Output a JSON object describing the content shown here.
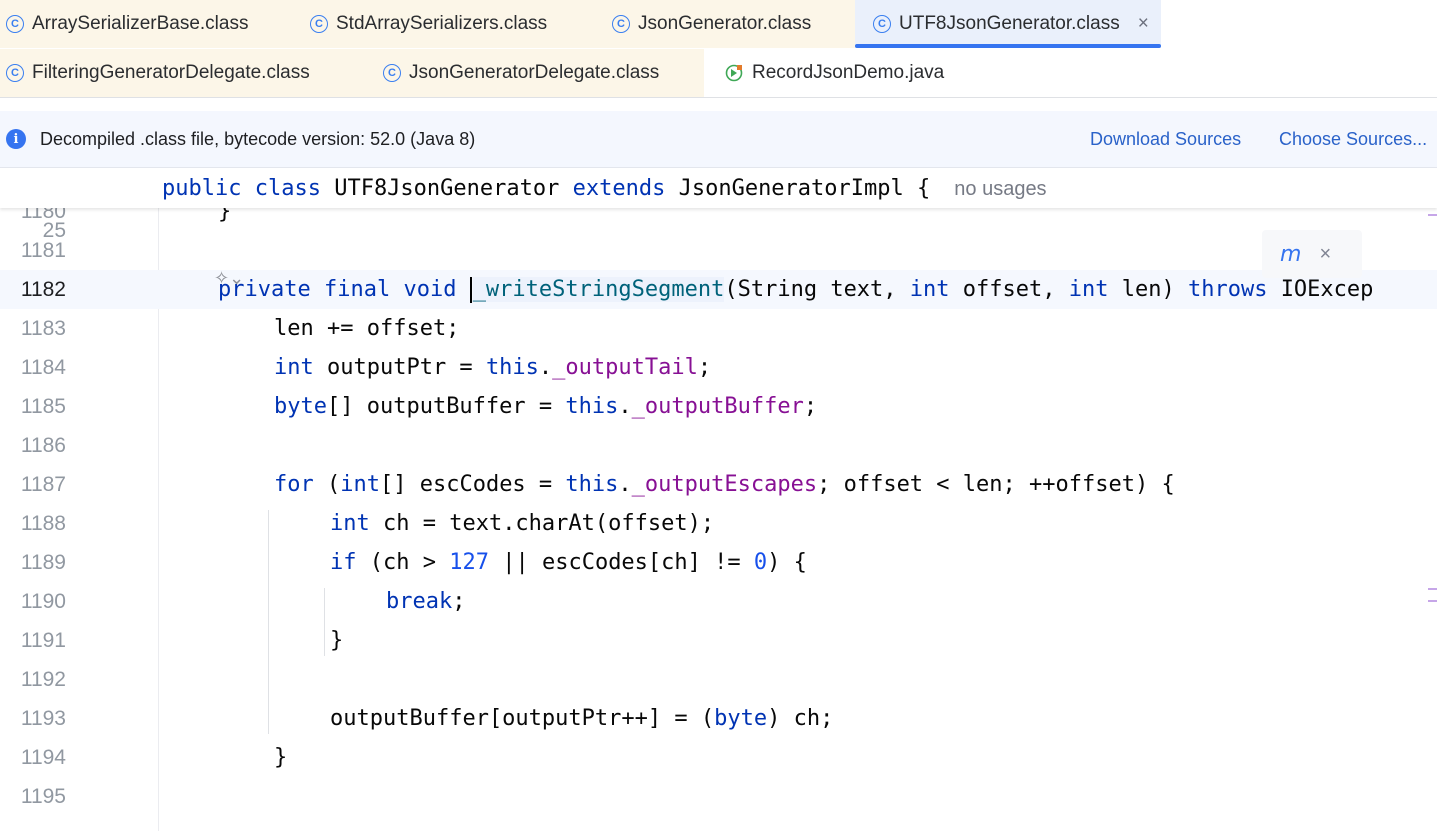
{
  "tabs_row1": [
    {
      "label": "ArraySerializerBase.class",
      "icon": "class-icon",
      "active": false
    },
    {
      "label": "StdArraySerializers.class",
      "icon": "class-icon",
      "active": false
    },
    {
      "label": "JsonGenerator.class",
      "icon": "class-icon",
      "active": false
    },
    {
      "label": "UTF8JsonGenerator.class",
      "icon": "class-icon",
      "active": true
    }
  ],
  "tabs_row2": [
    {
      "label": "FilteringGeneratorDelegate.class",
      "icon": "class-icon"
    },
    {
      "label": "JsonGeneratorDelegate.class",
      "icon": "class-icon"
    },
    {
      "label": "RecordJsonDemo.java",
      "icon": "java-file-icon"
    }
  ],
  "close_glyph": "×",
  "class_glyph": "C",
  "banner": {
    "info_glyph": "i",
    "text": "Decompiled .class file, bytecode version: 52.0 (Java 8)",
    "download_sources": "Download Sources",
    "choose_sources": "Choose Sources..."
  },
  "sticky_header": {
    "line_number": "25",
    "code": [
      {
        "t": "public ",
        "c": "kw"
      },
      {
        "t": "class ",
        "c": "kw"
      },
      {
        "t": "UTF8JsonGenerator ",
        "c": "plain"
      },
      {
        "t": "extends ",
        "c": "kw"
      },
      {
        "t": "JsonGeneratorImpl {",
        "c": "plain"
      }
    ],
    "hint": "no usages"
  },
  "popup": {
    "icon": "maven-reload-icon",
    "glyph": "m",
    "close": "×"
  },
  "ai_glyph": "✧⌄",
  "lines": [
    {
      "n": "1180",
      "tokens": [
        {
          "t": "}",
          "c": "plain"
        }
      ]
    },
    {
      "n": "1181",
      "tokens": []
    },
    {
      "n": "1182",
      "tokens": [
        {
          "t": "private ",
          "c": "kw"
        },
        {
          "t": "final ",
          "c": "kw"
        },
        {
          "t": "void ",
          "c": "kw"
        },
        {
          "t": "_writeStringSegment",
          "c": "methodname"
        },
        {
          "t": "(String text, ",
          "c": "plain"
        },
        {
          "t": "int ",
          "c": "kw"
        },
        {
          "t": "offset, ",
          "c": "plain"
        },
        {
          "t": "int ",
          "c": "kw"
        },
        {
          "t": "len) ",
          "c": "plain"
        },
        {
          "t": "throws ",
          "c": "kw"
        },
        {
          "t": "IOExcep",
          "c": "plain"
        }
      ]
    },
    {
      "n": "1183",
      "tokens": [
        {
          "t": "len += offset;",
          "c": "plain"
        }
      ]
    },
    {
      "n": "1184",
      "tokens": [
        {
          "t": "int ",
          "c": "kw"
        },
        {
          "t": "outputPtr = ",
          "c": "plain"
        },
        {
          "t": "this",
          "c": "kw"
        },
        {
          "t": ".",
          "c": "plain"
        },
        {
          "t": "_outputTail",
          "c": "fld"
        },
        {
          "t": ";",
          "c": "plain"
        }
      ]
    },
    {
      "n": "1185",
      "tokens": [
        {
          "t": "byte",
          "c": "kw"
        },
        {
          "t": "[] outputBuffer = ",
          "c": "plain"
        },
        {
          "t": "this",
          "c": "kw"
        },
        {
          "t": ".",
          "c": "plain"
        },
        {
          "t": "_outputBuffer",
          "c": "fld"
        },
        {
          "t": ";",
          "c": "plain"
        }
      ]
    },
    {
      "n": "1186",
      "tokens": []
    },
    {
      "n": "1187",
      "tokens": [
        {
          "t": "for ",
          "c": "kw"
        },
        {
          "t": "(",
          "c": "plain"
        },
        {
          "t": "int",
          "c": "kw"
        },
        {
          "t": "[] escCodes = ",
          "c": "plain"
        },
        {
          "t": "this",
          "c": "kw"
        },
        {
          "t": ".",
          "c": "plain"
        },
        {
          "t": "_outputEscapes",
          "c": "fld"
        },
        {
          "t": "; offset < len; ++offset) {",
          "c": "plain"
        }
      ]
    },
    {
      "n": "1188",
      "tokens": [
        {
          "t": "int ",
          "c": "kw"
        },
        {
          "t": "ch = text.charAt(offset);",
          "c": "plain"
        }
      ]
    },
    {
      "n": "1189",
      "tokens": [
        {
          "t": "if ",
          "c": "kw"
        },
        {
          "t": "(ch > ",
          "c": "plain"
        },
        {
          "t": "127",
          "c": "num"
        },
        {
          "t": " || escCodes[ch] != ",
          "c": "plain"
        },
        {
          "t": "0",
          "c": "num"
        },
        {
          "t": ") {",
          "c": "plain"
        }
      ]
    },
    {
      "n": "1190",
      "tokens": [
        {
          "t": "break",
          "c": "kw"
        },
        {
          "t": ";",
          "c": "plain"
        }
      ]
    },
    {
      "n": "1191",
      "tokens": [
        {
          "t": "}",
          "c": "plain"
        }
      ]
    },
    {
      "n": "1192",
      "tokens": []
    },
    {
      "n": "1193",
      "tokens": [
        {
          "t": "outputBuffer[outputPtr++] = (",
          "c": "plain"
        },
        {
          "t": "byte",
          "c": "kw"
        },
        {
          "t": ") ch;",
          "c": "plain"
        }
      ]
    },
    {
      "n": "1194",
      "tokens": [
        {
          "t": "}",
          "c": "plain"
        }
      ]
    },
    {
      "n": "1195",
      "tokens": []
    }
  ]
}
